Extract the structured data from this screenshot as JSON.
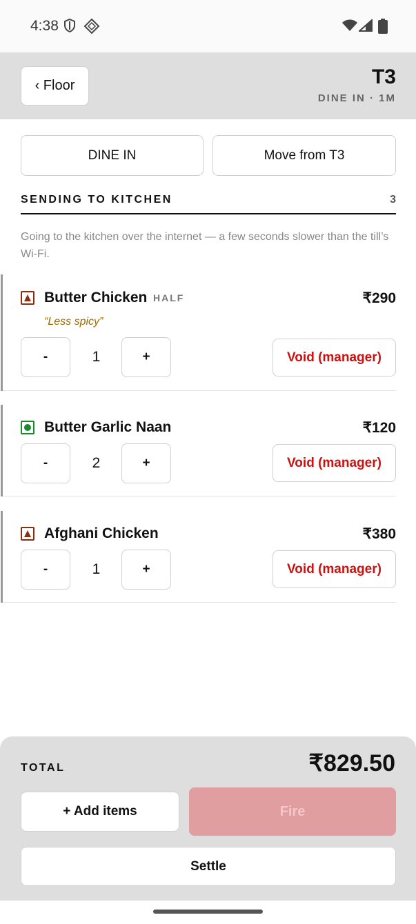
{
  "status_bar": {
    "time": "4:38"
  },
  "header": {
    "back_label": "‹ Floor",
    "table_id": "T3",
    "table_sub": "DINE IN · 1M"
  },
  "order_type": {
    "dine_in_label": "DINE IN",
    "move_label": "Move from T3"
  },
  "section": {
    "title": "SENDING TO KITCHEN",
    "count": "3"
  },
  "note": "Going to the kitchen over the internet — a few seconds slower than the till’s Wi-Fi.",
  "items": [
    {
      "name": "Butter Chicken",
      "tag": "HALF",
      "note": "“Less spicy”",
      "price": "₹290",
      "qty": "1",
      "veg": false,
      "minus": "-",
      "plus": "+",
      "void_label": "Void (manager)"
    },
    {
      "name": "Butter Garlic Naan",
      "tag": "",
      "note": "",
      "price": "₹120",
      "qty": "2",
      "veg": true,
      "minus": "-",
      "plus": "+",
      "void_label": "Void (manager)"
    },
    {
      "name": "Afghani Chicken",
      "tag": "",
      "note": "",
      "price": "₹380",
      "qty": "1",
      "veg": false,
      "minus": "-",
      "plus": "+",
      "void_label": "Void (manager)"
    }
  ],
  "footer": {
    "total_label": "TOTAL",
    "total_value": "₹829.50",
    "add_items_label": "+ Add items",
    "fire_label": "Fire",
    "settle_label": "Settle"
  },
  "icons": {
    "shield": "shield-icon",
    "chip": "chip-icon",
    "wifi": "wifi-icon",
    "signal": "signal-icon",
    "battery": "battery-icon",
    "veg": "veg-icon",
    "non_veg": "non-veg-icon"
  },
  "colors": {
    "void": "#cc1111",
    "veg": "#1a8a2e",
    "non_veg": "#8b2e10",
    "fire_disabled": "#e09ea0",
    "note": "#a06a00"
  }
}
